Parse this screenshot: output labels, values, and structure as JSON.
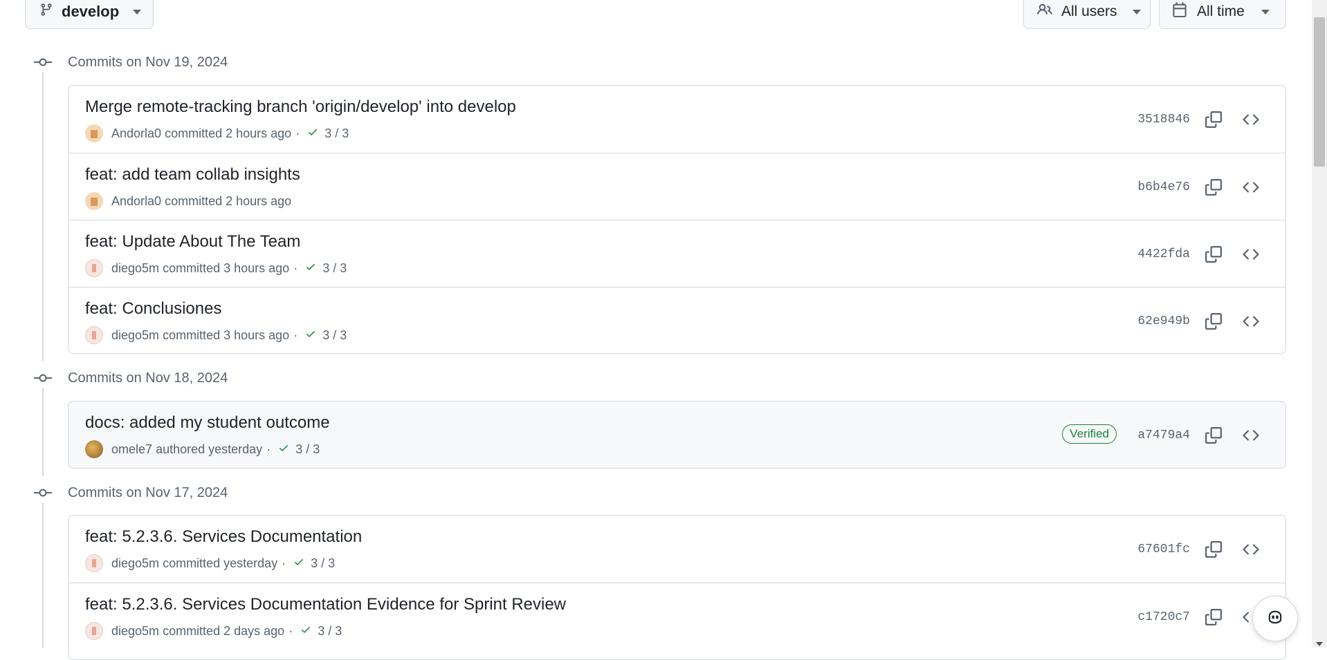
{
  "toolbar": {
    "branch_label": "develop",
    "users_label": "All users",
    "time_label": "All time",
    "icons": {
      "branch": "git-branch-icon",
      "users": "people-icon",
      "time": "calendar-icon"
    }
  },
  "groups": [
    {
      "date_label": "Commits on Nov 19, 2024",
      "commits": [
        {
          "message": "Merge remote-tracking branch 'origin/develop' into develop",
          "author": "Andorla0",
          "action": "committed",
          "time": "2 hours ago",
          "checks": "3 / 3",
          "hash": "3518846",
          "verified": ""
        },
        {
          "message": "feat: add team collab insights",
          "author": "Andorla0",
          "action": "committed",
          "time": "2 hours ago",
          "checks": "",
          "hash": "b6b4e76",
          "verified": ""
        },
        {
          "message": "feat: Update About The Team",
          "author": "diego5m",
          "action": "committed",
          "time": "3 hours ago",
          "checks": "3 / 3",
          "hash": "4422fda",
          "verified": ""
        },
        {
          "message": "feat: Conclusiones",
          "author": "diego5m",
          "action": "committed",
          "time": "3 hours ago",
          "checks": "3 / 3",
          "hash": "62e949b",
          "verified": ""
        }
      ]
    },
    {
      "date_label": "Commits on Nov 18, 2024",
      "commits": [
        {
          "message": "docs: added my student outcome",
          "author": "omele7",
          "action": "authored",
          "time": "yesterday",
          "checks": "3 / 3",
          "hash": "a7479a4",
          "verified": "Verified"
        }
      ]
    },
    {
      "date_label": "Commits on Nov 17, 2024",
      "commits": [
        {
          "message": "feat: 5.2.3.6. Services Documentation",
          "author": "diego5m",
          "action": "committed",
          "time": "yesterday",
          "checks": "3 / 3",
          "hash": "67601fc",
          "verified": ""
        },
        {
          "message": "feat: 5.2.3.6. Services Documentation Evidence for Sprint Review",
          "author": "diego5m",
          "action": "committed",
          "time": "2 days ago",
          "checks": "3 / 3",
          "hash": "c1720c7",
          "verified": ""
        }
      ]
    }
  ],
  "colors": {
    "success": "#1a7f37",
    "muted": "#59636e",
    "border": "#d1d9e0"
  }
}
